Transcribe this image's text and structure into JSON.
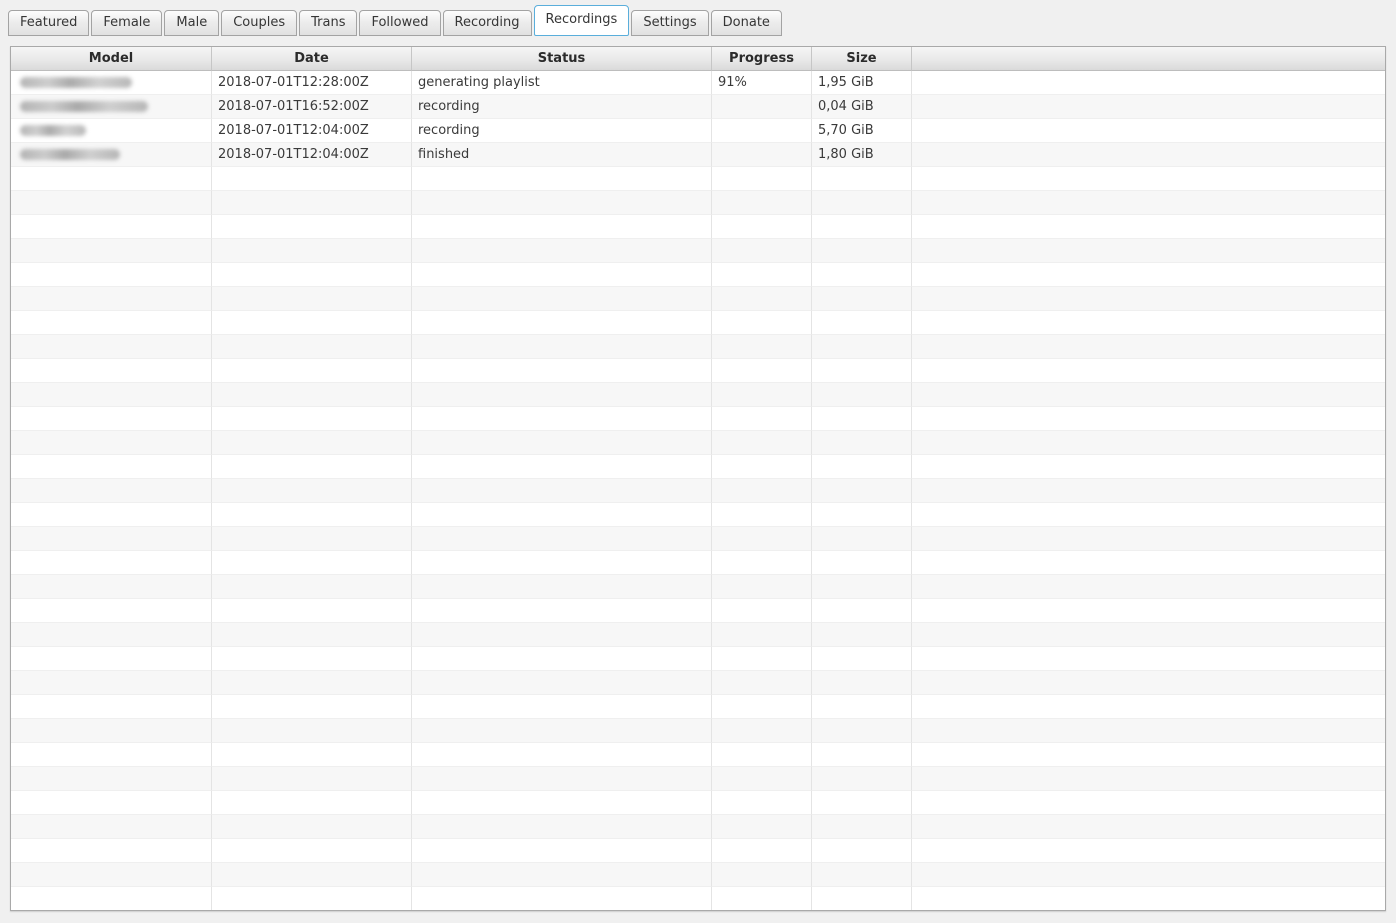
{
  "tabs": {
    "items": [
      {
        "label": "Featured"
      },
      {
        "label": "Female"
      },
      {
        "label": "Male"
      },
      {
        "label": "Couples"
      },
      {
        "label": "Trans"
      },
      {
        "label": "Followed"
      },
      {
        "label": "Recording"
      },
      {
        "label": "Recordings"
      },
      {
        "label": "Settings"
      },
      {
        "label": "Donate"
      }
    ],
    "active": "Recordings"
  },
  "table": {
    "columns": [
      {
        "label": "Model"
      },
      {
        "label": "Date"
      },
      {
        "label": "Status"
      },
      {
        "label": "Progress"
      },
      {
        "label": "Size"
      },
      {
        "label": ""
      }
    ],
    "rows": [
      {
        "model_redacted": true,
        "model_blur_width": 112,
        "date": "2018-07-01T12:28:00Z",
        "status": "generating playlist",
        "progress": "91%",
        "size": "1,95 GiB"
      },
      {
        "model_redacted": true,
        "model_blur_width": 128,
        "date": "2018-07-01T16:52:00Z",
        "status": "recording",
        "progress": "",
        "size": "0,04 GiB"
      },
      {
        "model_redacted": true,
        "model_blur_width": 66,
        "date": "2018-07-01T12:04:00Z",
        "status": "recording",
        "progress": "",
        "size": "5,70 GiB"
      },
      {
        "model_redacted": true,
        "model_blur_width": 100,
        "date": "2018-07-01T12:04:00Z",
        "status": "finished",
        "progress": "",
        "size": "1,80 GiB"
      }
    ],
    "empty_row_count": 31
  },
  "colors": {
    "page_bg": "#f0f0f0",
    "active_tab_border": "#5aaedb",
    "row_stripe": "#f7f7f7",
    "table_border": "#a9a9a9"
  }
}
